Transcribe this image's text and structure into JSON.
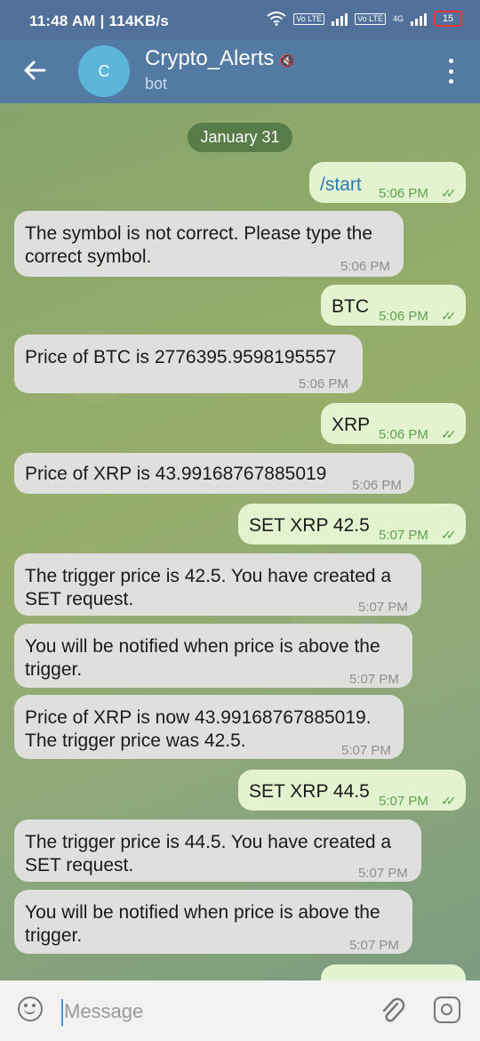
{
  "status": {
    "time": "11:48 AM | 114KB/s",
    "sim1": "Vo LTE",
    "sim2": "Vo LTE",
    "net": "4G",
    "battery": "15"
  },
  "header": {
    "avatar_letter": "C",
    "title": "Crypto_Alerts",
    "subtitle": "bot",
    "muted_icon": "speaker-muted-icon"
  },
  "chat": {
    "date": "January 31",
    "messages": [
      {
        "dir": "out",
        "text": "/start",
        "time": "5:06 PM"
      },
      {
        "dir": "in",
        "text": "The symbol is not correct. Please type the correct symbol.",
        "time": "5:06 PM"
      },
      {
        "dir": "out",
        "text": "BTC",
        "time": "5:06 PM"
      },
      {
        "dir": "in",
        "text": "Price of BTC is 2776395.9598195557",
        "time": "5:06 PM"
      },
      {
        "dir": "out",
        "text": "XRP",
        "time": "5:06 PM"
      },
      {
        "dir": "in",
        "text": "Price of XRP is 43.99168767885019",
        "time": "5:06 PM"
      },
      {
        "dir": "out",
        "text": "SET XRP 42.5",
        "time": "5:07 PM"
      },
      {
        "dir": "in",
        "text": "The trigger price is 42.5. You have created a SET request.",
        "time": "5:07 PM"
      },
      {
        "dir": "in",
        "text": "You will be notified when price is above the trigger.",
        "time": "5:07 PM"
      },
      {
        "dir": "in",
        "text": "Price of XRP is now 43.99168767885019. The trigger price was 42.5.",
        "time": "5:07 PM"
      },
      {
        "dir": "out",
        "text": "SET XRP 44.5",
        "time": "5:07 PM"
      },
      {
        "dir": "in",
        "text": "The trigger price is 44.5. You have created a SET request.",
        "time": "5:07 PM"
      },
      {
        "dir": "in",
        "text": "You will be notified when price is above the trigger.",
        "time": "5:07 PM"
      }
    ]
  },
  "input": {
    "placeholder": "Message"
  },
  "colors": {
    "header": "#527aa3",
    "incoming_bubble": "#dfe0dd",
    "outgoing_bubble": "#e4f3cf",
    "outgoing_time": "#5fa150",
    "command_link": "#2f7bb3"
  }
}
